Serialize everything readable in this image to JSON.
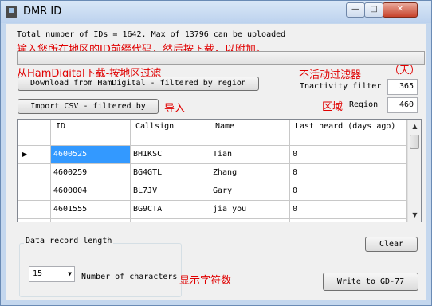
{
  "window": {
    "title": "DMR ID",
    "min_glyph": "—",
    "max_glyph": "□",
    "close_glyph": "✕"
  },
  "info": {
    "total_text": "Total number of IDs = 1642. Max of 13796 can be uploaded",
    "cn_prefix_hint": "输入您所在地区的ID前缀代码，然后按下载，以附加。",
    "cn_download_hint": "从HamDigital下载-按地区过滤",
    "cn_inactivity_hint": "不活动过滤器",
    "cn_days_hint": "（天）",
    "cn_import_hint": "导入",
    "cn_region_hint": "区域",
    "cn_chars_hint": "显示字符数"
  },
  "progress": {
    "value": 0
  },
  "buttons": {
    "download": "Download from HamDigital - filtered by region",
    "import_csv": "Import CSV - filtered by",
    "clear": "Clear",
    "write": "Write to GD-77"
  },
  "filters": {
    "inactivity_label": "Inactivity filter",
    "inactivity_value": "365",
    "region_label": "Region",
    "region_value": "460"
  },
  "table": {
    "columns": [
      "ID",
      "Callsign",
      "Name",
      "Last heard (days ago)"
    ],
    "rows": [
      [
        "4600525",
        "BH1KSC",
        "Tian",
        "0"
      ],
      [
        "4600259",
        "BG4GTL",
        "Zhang",
        "0"
      ],
      [
        "4600004",
        "BL7JV",
        "Gary",
        "0"
      ],
      [
        "4601555",
        "BG9CTA",
        "jia you",
        "0"
      ]
    ],
    "current_row_marker": "▶"
  },
  "data_record": {
    "group_label": "Data record length",
    "selected": "15",
    "suffix_label": "Number of characters"
  }
}
